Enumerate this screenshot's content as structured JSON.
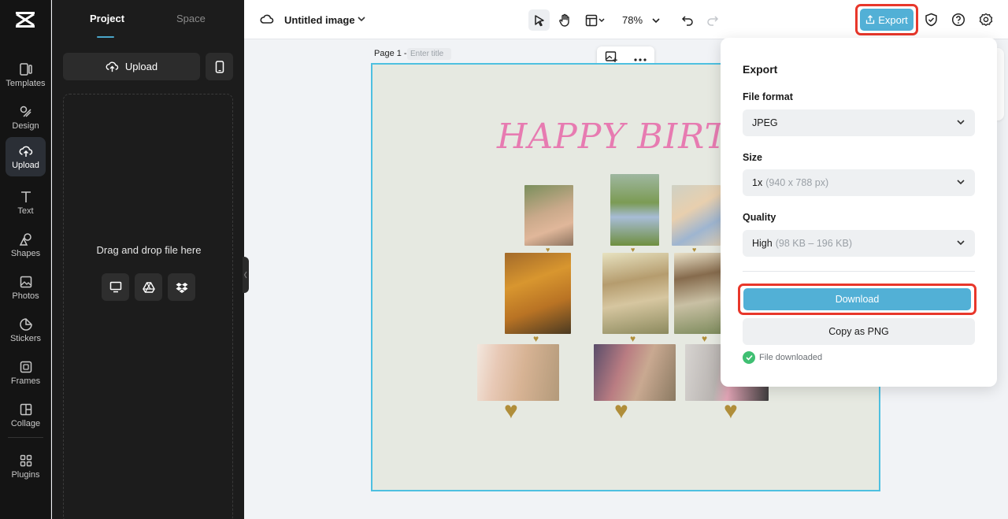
{
  "rail": {
    "items": [
      {
        "label": "Templates",
        "icon": "templates-icon"
      },
      {
        "label": "Design",
        "icon": "design-icon"
      },
      {
        "label": "Upload",
        "icon": "upload-icon",
        "active": true
      },
      {
        "label": "Text",
        "icon": "text-icon"
      },
      {
        "label": "Shapes",
        "icon": "shapes-icon"
      },
      {
        "label": "Photos",
        "icon": "photos-icon"
      },
      {
        "label": "Stickers",
        "icon": "stickers-icon"
      },
      {
        "label": "Frames",
        "icon": "frames-icon"
      },
      {
        "label": "Collage",
        "icon": "collage-icon"
      },
      {
        "label": "Plugins",
        "icon": "plugins-icon"
      }
    ]
  },
  "panel": {
    "tabs": [
      "Project",
      "Space"
    ],
    "upload_label": "Upload",
    "drop_text": "Drag and drop file here"
  },
  "topbar": {
    "doc_title": "Untitled image",
    "zoom": "78%",
    "export_label": "Export"
  },
  "canvas": {
    "page_label": "Page 1 -",
    "page_title_placeholder": "Enter title",
    "headline": "HAPPY BIRTHDAY"
  },
  "export_panel": {
    "title": "Export",
    "file_format_label": "File format",
    "file_format_value": "JPEG",
    "size_label": "Size",
    "size_value": "1x",
    "size_detail": "(940 x 788 px)",
    "quality_label": "Quality",
    "quality_value": "High",
    "quality_detail": "(98 KB – 196 KB)",
    "download_label": "Download",
    "copy_label": "Copy as PNG",
    "status_text": "File downloaded"
  },
  "colors": {
    "accent": "#52b0d6",
    "highlight_ring": "#e8372b",
    "headline": "#e77bb1",
    "heart": "#b08e3a",
    "success": "#3fbf72"
  }
}
